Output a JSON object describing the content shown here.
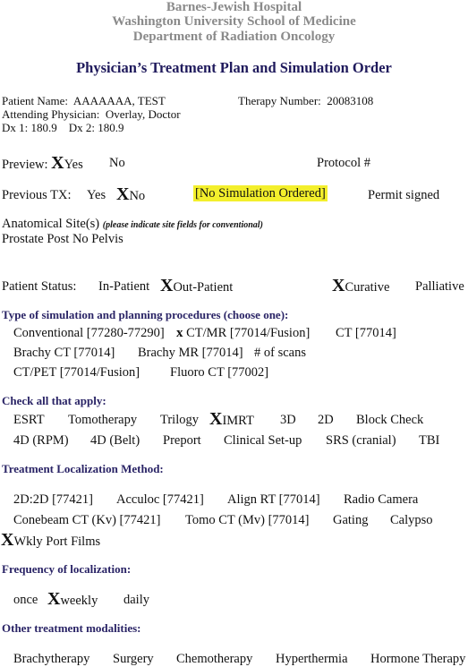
{
  "header": {
    "line1": "Barnes-Jewish Hospital",
    "line2": "Washington University School of Medicine",
    "line3": "Department of Radiation Oncology",
    "title": "Physician’s Treatment Plan and Simulation Order"
  },
  "patient": {
    "name_label": "Patient Name:",
    "name_value": "AAAAAAA, TEST",
    "therapy_label": "Therapy Number:",
    "therapy_value": "20083108",
    "physician_label": "Attending Physician:",
    "physician_value": "Overlay, Doctor",
    "dx1_label": "Dx 1:",
    "dx1_value": "180.9",
    "dx2_label": "Dx 2:",
    "dx2_value": "180.9"
  },
  "preview": {
    "label": "Preview:",
    "mark": "X",
    "yes": "Yes",
    "no": "No",
    "protocol_label": "Protocol #",
    "selected": "Yes"
  },
  "previous_tx": {
    "label": "Previous TX:",
    "yes": "Yes",
    "mark": "X",
    "no": "No",
    "selected": "No",
    "simulation_status": "[No Simulation Ordered]",
    "permit": "Permit signed",
    "highlight_color": "#f3ef2c"
  },
  "anatomical": {
    "label": "Anatomical Site(s)",
    "note": "(please indicate site fields for conventional)",
    "value": "Prostate Post No Pelvis"
  },
  "patient_status": {
    "label": "Patient Status:",
    "in_patient": "In-Patient",
    "mark1": "X",
    "out_patient": "Out-Patient",
    "mark2": "X",
    "curative": "Curative",
    "palliative": "Palliative",
    "selected_status": "Out-Patient",
    "selected_intent": "Curative"
  },
  "simulation": {
    "heading": "Type of simulation and planning procedures (choose one):",
    "conventional": "Conventional [77280-77290]",
    "mark": "x",
    "ct_mr": "CT/MR [77014/Fusion]",
    "ct": "CT [77014]",
    "brachy_ct": "Brachy CT [77014]",
    "brachy_mr": "Brachy MR [77014]",
    "scans": "# of scans",
    "ct_pet": "CT/PET [77014/Fusion]",
    "fluoro": "Fluoro CT [77002]",
    "selected": "CT/MR [77014/Fusion]"
  },
  "check_all": {
    "heading": "Check all that apply:",
    "esrt": "ESRT",
    "tomo": "Tomotherapy",
    "trilogy": "Trilogy",
    "mark": "X",
    "imrt": "IMRT",
    "d3": "3D",
    "d2": "2D",
    "block": "Block Check",
    "rpm": "4D (RPM)",
    "belt": "4D (Belt)",
    "preport": "Preport",
    "clinical": "Clinical Set-up",
    "srs": "SRS (cranial)",
    "tbi": "TBI",
    "selected": [
      "IMRT"
    ]
  },
  "localization": {
    "heading": "Treatment Localization Method:",
    "d2d2": "2D:2D [77421]",
    "acculoc": "Acculoc [77421]",
    "align": "Align RT [77014]",
    "radio": "Radio Camera",
    "conebeam": "Conebeam CT (Kv) [77421]",
    "tomo_ct": "Tomo CT (Mv) [77014]",
    "gating": "Gating",
    "calypso": "Calypso",
    "mark": "X",
    "port": "Wkly Port Films",
    "selected": [
      "Wkly Port Films"
    ]
  },
  "frequency": {
    "heading": "Frequency of localization:",
    "once": "once",
    "mark": "X",
    "weekly": "weekly",
    "daily": "daily",
    "selected": "weekly"
  },
  "modalities": {
    "heading": "Other treatment modalities:",
    "brachy": "Brachytherapy",
    "surgery": "Surgery",
    "chemo": "Chemotherapy",
    "hyper": "Hyperthermia",
    "hormone": "Hormone Therapy"
  }
}
